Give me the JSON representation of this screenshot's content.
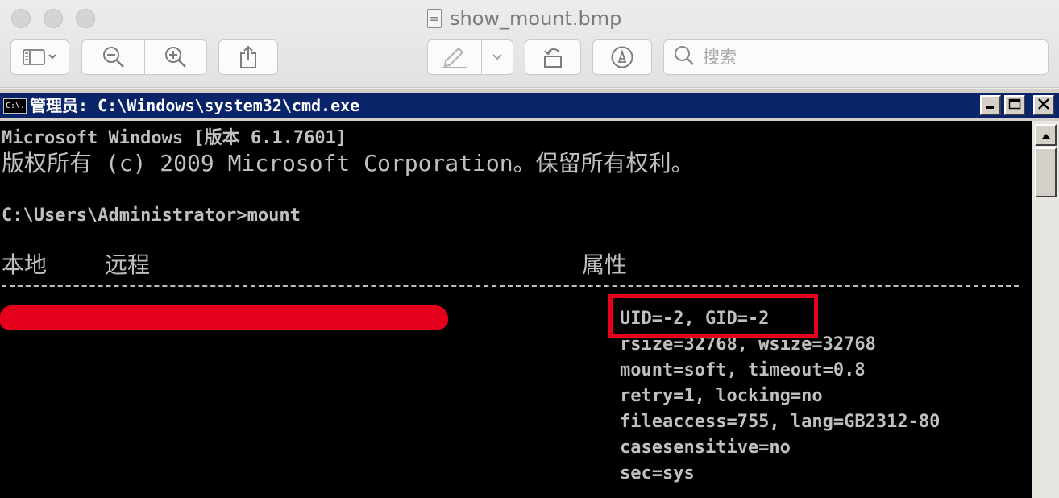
{
  "preview_window": {
    "file_name": "show_mount.bmp",
    "search_placeholder": "搜索",
    "toolbar_icons": [
      "sidebar-icon",
      "zoom-out-icon",
      "zoom-in-icon",
      "share-icon",
      "markup-pen-icon",
      "rotate-icon",
      "annotate-icon",
      "search-icon"
    ]
  },
  "cmd_window": {
    "title": "管理员: C:\\Windows\\system32\\cmd.exe",
    "icon_text": "C:\\."
  },
  "console": {
    "lines": [
      "Microsoft Windows [版本 6.1.7601]",
      "版权所有 (c) 2009 Microsoft Corporation。保留所有权利。",
      "",
      "C:\\Users\\Administrator>mount"
    ],
    "headers": {
      "local": "本地",
      "remote": "远程",
      "properties": "属性"
    },
    "mount_options": [
      "UID=-2, GID=-2",
      "rsize=32768, wsize=32768",
      "mount=soft, timeout=0.8",
      "retry=1, locking=no",
      "fileaccess=755, lang=GB2312-80",
      "casesensitive=no",
      "sec=sys"
    ]
  },
  "colors": {
    "console_bg": "#000000",
    "console_text": "#c0c0c0",
    "cmd_titlebar": "#0a246a",
    "annotation_red": "#e4001c"
  }
}
